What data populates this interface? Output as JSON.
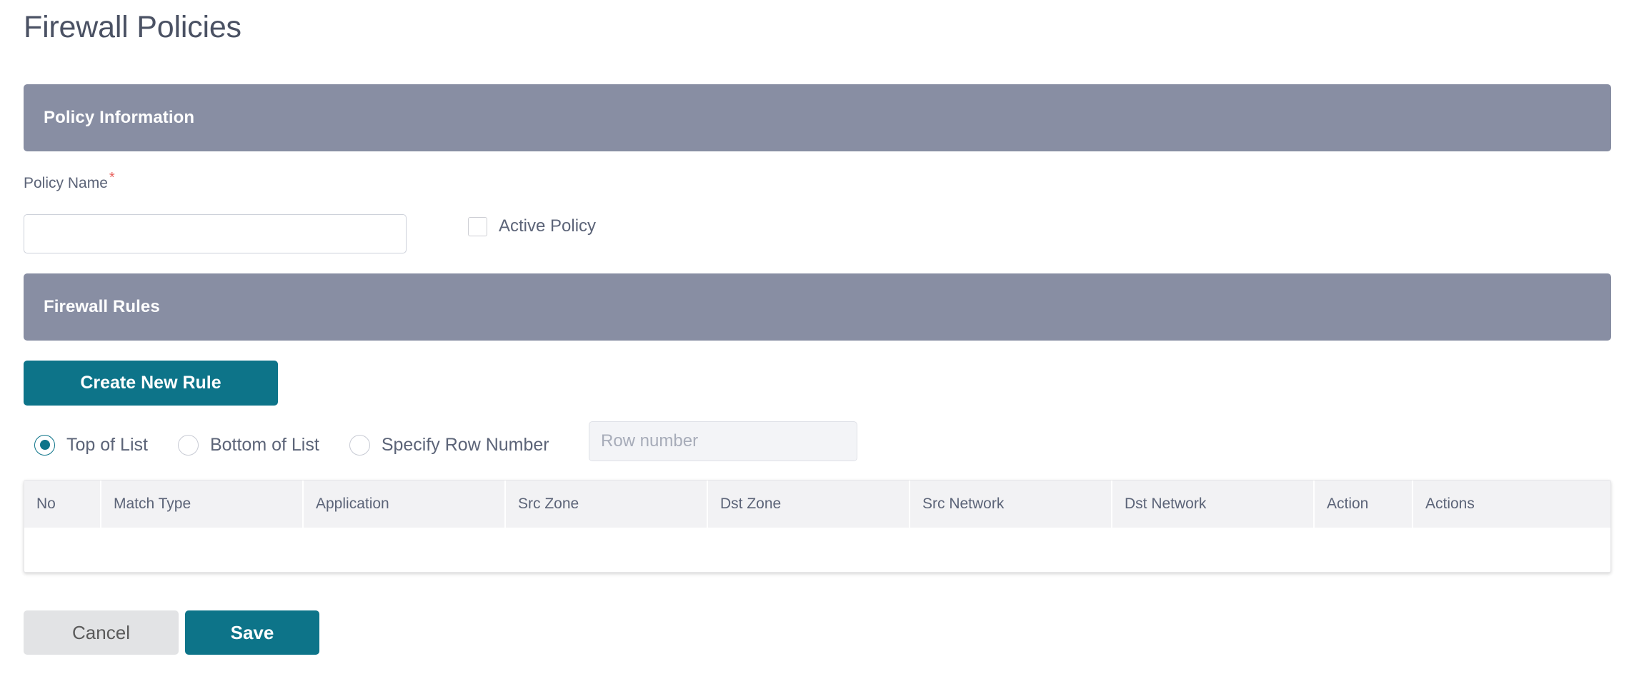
{
  "page": {
    "title": "Firewall Policies"
  },
  "policy_information": {
    "section_title": "Policy Information",
    "policy_name": {
      "label": "Policy Name",
      "required_marker": "*",
      "value": "",
      "placeholder": ""
    },
    "active_policy": {
      "label": "Active Policy",
      "checked": false
    }
  },
  "firewall_rules": {
    "section_title": "Firewall Rules",
    "create_button_label": "Create New Rule",
    "placement_options": [
      {
        "label": "Top of List",
        "selected": true
      },
      {
        "label": "Bottom of List",
        "selected": false
      },
      {
        "label": "Specify Row Number",
        "selected": false
      }
    ],
    "row_number_input": {
      "placeholder": "Row number",
      "value": "",
      "disabled": true
    },
    "table": {
      "columns": [
        "No",
        "Match Type",
        "Application",
        "Src Zone",
        "Dst Zone",
        "Src Network",
        "Dst Network",
        "Action",
        "Actions"
      ],
      "rows": []
    }
  },
  "footer": {
    "cancel_label": "Cancel",
    "save_label": "Save"
  },
  "colors": {
    "section_bar": "#888ea3",
    "accent_teal": "#0d7489",
    "text_slate": "#5c6478",
    "required_red": "#e8635f",
    "table_header_bg": "#f2f2f4",
    "cancel_bg": "#e2e3e5"
  }
}
